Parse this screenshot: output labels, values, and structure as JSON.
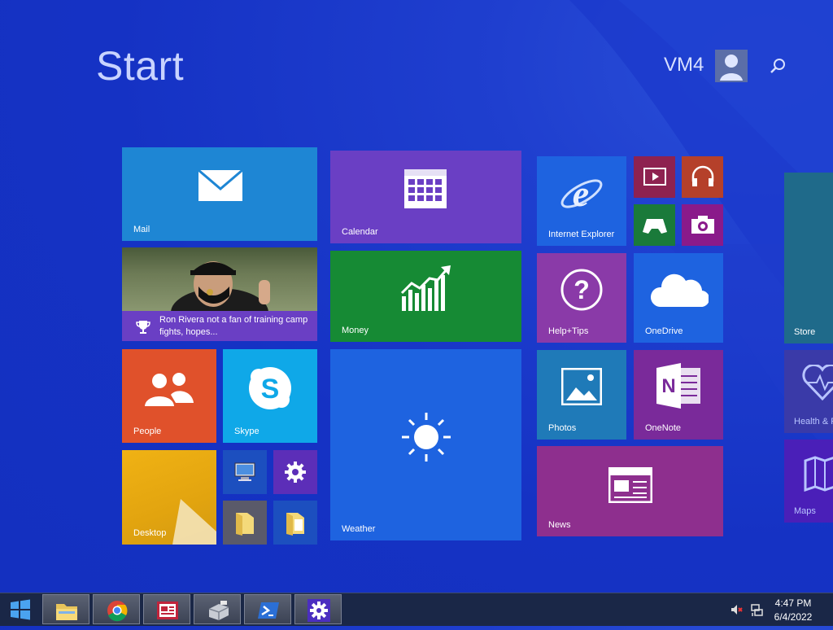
{
  "header": {
    "title": "Start",
    "user_name": "VM4"
  },
  "tiles": {
    "mail": "Mail",
    "calendar": "Calendar",
    "internet_explorer": "Internet Explorer",
    "news_feed_headline": "Ron Rivera not a fan of training camp fights, hopes...",
    "money": "Money",
    "help_tips": "Help+Tips",
    "onedrive": "OneDrive",
    "people": "People",
    "skype": "Skype",
    "weather": "Weather",
    "photos": "Photos",
    "onenote": "OneNote",
    "desktop": "Desktop",
    "news": "News",
    "store": "Store",
    "health": "Health & F",
    "maps": "Maps"
  },
  "taskbar": {
    "pinned": [
      "file-explorer",
      "chrome",
      "news-app",
      "server-manager",
      "powershell",
      "settings"
    ]
  },
  "clock": {
    "time": "4:47 PM",
    "date": "6/4/2022"
  },
  "colors": {
    "background": "#1532c4",
    "mail": "#1e86d4",
    "calendar": "#6a3fc4",
    "money": "#168a34",
    "people": "#e0512b",
    "skype": "#0fa8e8",
    "weather": "#1e63e0",
    "news": "#8e2f8e",
    "taskbar": "#1a2747"
  }
}
